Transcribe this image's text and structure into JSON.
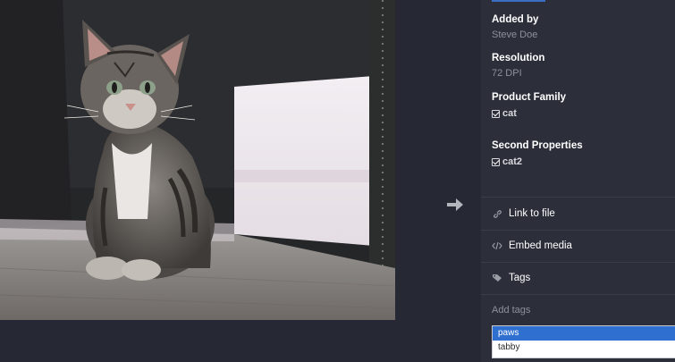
{
  "details": {
    "added_by": {
      "label": "Added by",
      "value": "Steve Doe"
    },
    "resolution": {
      "label": "Resolution",
      "value": "72 DPI"
    },
    "product_family": {
      "label": "Product Family",
      "value": "cat",
      "checked": true
    },
    "second_properties": {
      "label": "Second Properties",
      "value": "cat2",
      "checked": true
    }
  },
  "actions": {
    "link_to_file": {
      "label": "Link to file",
      "icon": "link-icon"
    },
    "embed_media": {
      "label": "Embed media",
      "icon": "code-icon"
    },
    "tags": {
      "label": "Tags",
      "icon": "tag-icon"
    }
  },
  "tags_input": {
    "label": "Add tags",
    "options": [
      "paws",
      "tabby"
    ],
    "selected": "paws"
  },
  "colors": {
    "background": "#262833",
    "panel": "#2c2f3a",
    "selection": "#2f6fd0"
  },
  "navigation": {
    "next_icon": "arrow-right-icon"
  }
}
